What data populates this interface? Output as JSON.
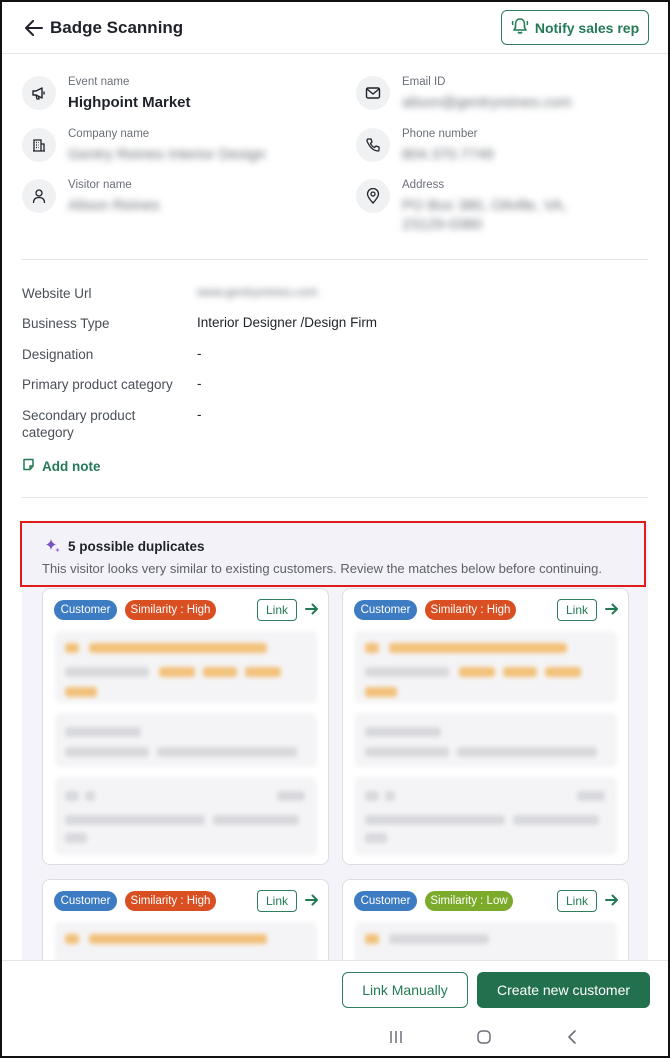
{
  "header": {
    "title": "Badge Scanning",
    "notify_label": "Notify sales rep"
  },
  "info": {
    "event_label": "Event name",
    "event_value": "Highpoint Market",
    "email_label": "Email ID",
    "email_value": "alison@gentryreines.com",
    "company_label": "Company name",
    "company_value": "Gentry Reines Interior Design",
    "phone_label": "Phone number",
    "phone_value": "804.370.7749",
    "visitor_label": "Visitor name",
    "visitor_value": "Alison Reines",
    "address_label": "Address",
    "address_line1": "PO Box 380, Oilville, VA,",
    "address_line2": "23129-0380"
  },
  "details": {
    "website_label": "Website Url",
    "website_value": "www.gentryreines.com",
    "business_label": "Business Type",
    "business_value": "Interior Designer /Design Firm",
    "designation_label": "Designation",
    "designation_value": "-",
    "primary_label": "Primary product category",
    "primary_value": "-",
    "secondary_label_1": "Secondary product",
    "secondary_label_2": "category",
    "secondary_value": "-",
    "add_note_label": "Add note"
  },
  "duplicates": {
    "title": "5 possible duplicates",
    "description": "This visitor looks very similar to existing customers. Review the matches below before continuing.",
    "cards": [
      {
        "type": "Customer",
        "similarity": "Similarity : High",
        "link": "Link"
      },
      {
        "type": "Customer",
        "similarity": "Similarity : High",
        "link": "Link"
      },
      {
        "type": "Customer",
        "similarity": "Similarity : High",
        "link": "Link"
      },
      {
        "type": "Customer",
        "similarity": "Similarity : Low",
        "link": "Link"
      }
    ]
  },
  "footer": {
    "link_manually": "Link Manually",
    "create_new": "Create new customer"
  },
  "colors": {
    "primary_green": "#23704f",
    "customer_badge": "#3d7bc2",
    "high_badge": "#d94f22",
    "low_badge": "#7caa2b",
    "highlight_border": "#e01b1b"
  }
}
